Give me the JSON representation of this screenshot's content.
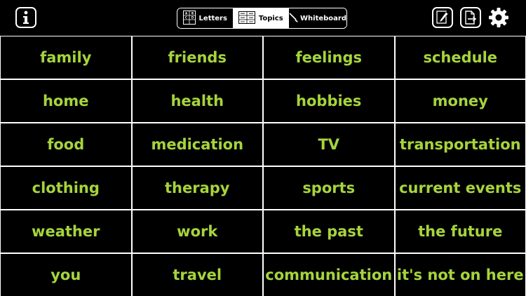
{
  "toolbar": {
    "info_icon": "info-icon",
    "edit_icon": "pencil-icon",
    "export_icon": "export-icon",
    "settings_icon": "gear-icon",
    "tabs": [
      {
        "label": "Letters",
        "icon": "letters-grid-icon",
        "active": false
      },
      {
        "label": "Topics",
        "icon": "topics-grid-icon",
        "active": true
      },
      {
        "label": "Whiteboard",
        "icon": "brush-icon",
        "active": false
      }
    ]
  },
  "topics": [
    [
      "family",
      "friends",
      "feelings",
      "schedule"
    ],
    [
      "home",
      "health",
      "hobbies",
      "money"
    ],
    [
      "food",
      "medication",
      "TV",
      "transportation"
    ],
    [
      "clothing",
      "therapy",
      "sports",
      "current events"
    ],
    [
      "weather",
      "work",
      "the past",
      "the future"
    ],
    [
      "you",
      "travel",
      "communication",
      "it's not on here"
    ]
  ],
  "colors": {
    "background": "#000000",
    "text_accent": "#a6d43c",
    "borders": "#ffffff"
  }
}
